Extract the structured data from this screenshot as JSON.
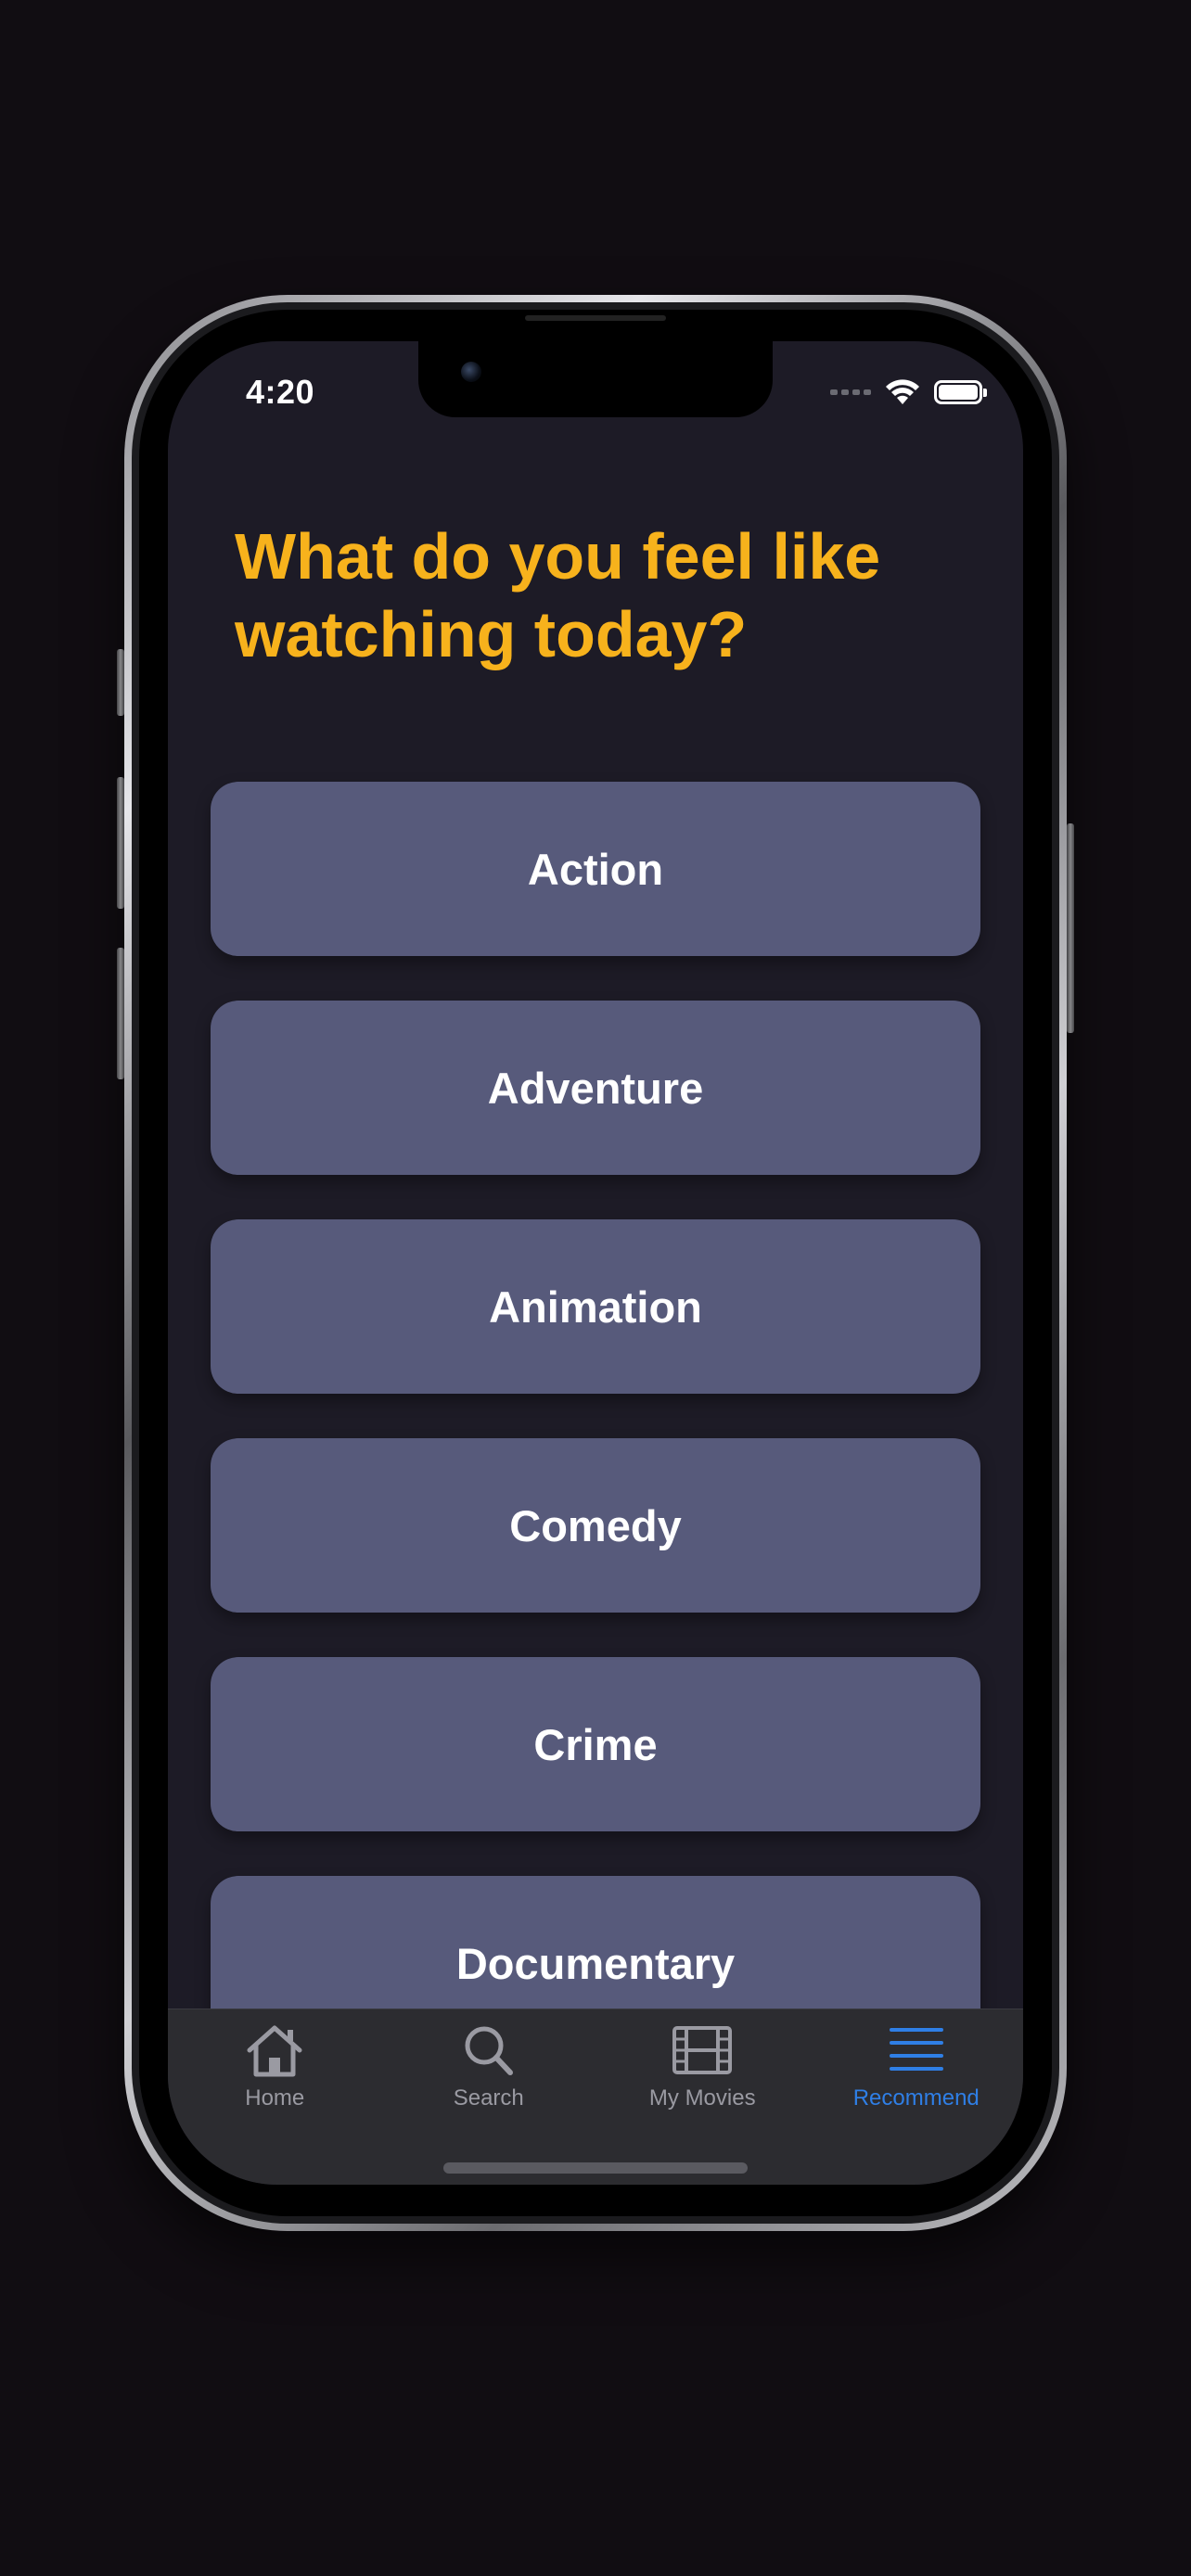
{
  "status_bar": {
    "time": "4:20"
  },
  "headline": "What do you feel like watching today?",
  "genres": [
    "Action",
    "Adventure",
    "Animation",
    "Comedy",
    "Crime",
    "Documentary"
  ],
  "tab_bar": {
    "items": [
      {
        "label": "Home",
        "icon": "house-icon",
        "active": false
      },
      {
        "label": "Search",
        "icon": "magnifier-icon",
        "active": false
      },
      {
        "label": "My Movies",
        "icon": "film-strip-icon",
        "active": false
      },
      {
        "label": "Recommend",
        "icon": "list-lines-icon",
        "active": true
      }
    ]
  },
  "colors": {
    "accent_headline": "#f7b21c",
    "screen_background": "#1d1b26",
    "genre_button": "#575a7b",
    "tab_active": "#2f7fe6",
    "tab_inactive": "#9a9aa2"
  }
}
